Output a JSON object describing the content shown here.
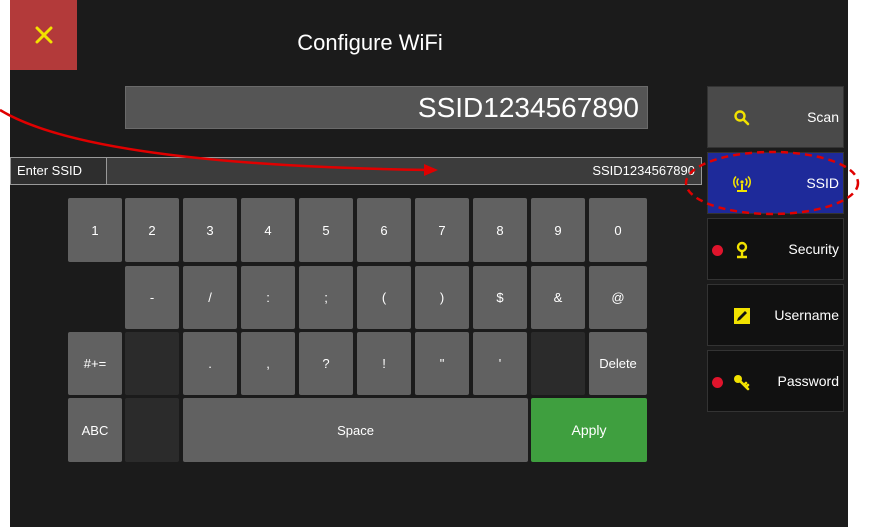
{
  "header": {
    "title": "Configure WiFi",
    "close_icon": "close-icon"
  },
  "ssid_display": {
    "value": "SSID1234567890"
  },
  "entry": {
    "label": "Enter SSID",
    "value": "SSID1234567890"
  },
  "keyboard": {
    "row1": [
      "1",
      "2",
      "3",
      "4",
      "5",
      "6",
      "7",
      "8",
      "9",
      "0"
    ],
    "row2": [
      "-",
      "/",
      ":",
      ";",
      "(",
      ")",
      "$",
      "&",
      "@"
    ],
    "row3": {
      "mode": "#+=",
      "keys": [
        ".",
        ",",
        "?",
        "!",
        "\"",
        "'"
      ],
      "delete": "Delete"
    },
    "row4": {
      "abc": "ABC",
      "space": "Space",
      "apply": "Apply"
    }
  },
  "sidebar": {
    "scan": "Scan",
    "ssid": "SSID",
    "security": "Security",
    "username": "Username",
    "password": "Password"
  },
  "colors": {
    "close": "#b33a3a",
    "active": "#1e2a9a",
    "apply": "#3f9f3f",
    "icon": "#f2e200",
    "required_dot": "#e0142c",
    "annotation": "#e00000"
  }
}
